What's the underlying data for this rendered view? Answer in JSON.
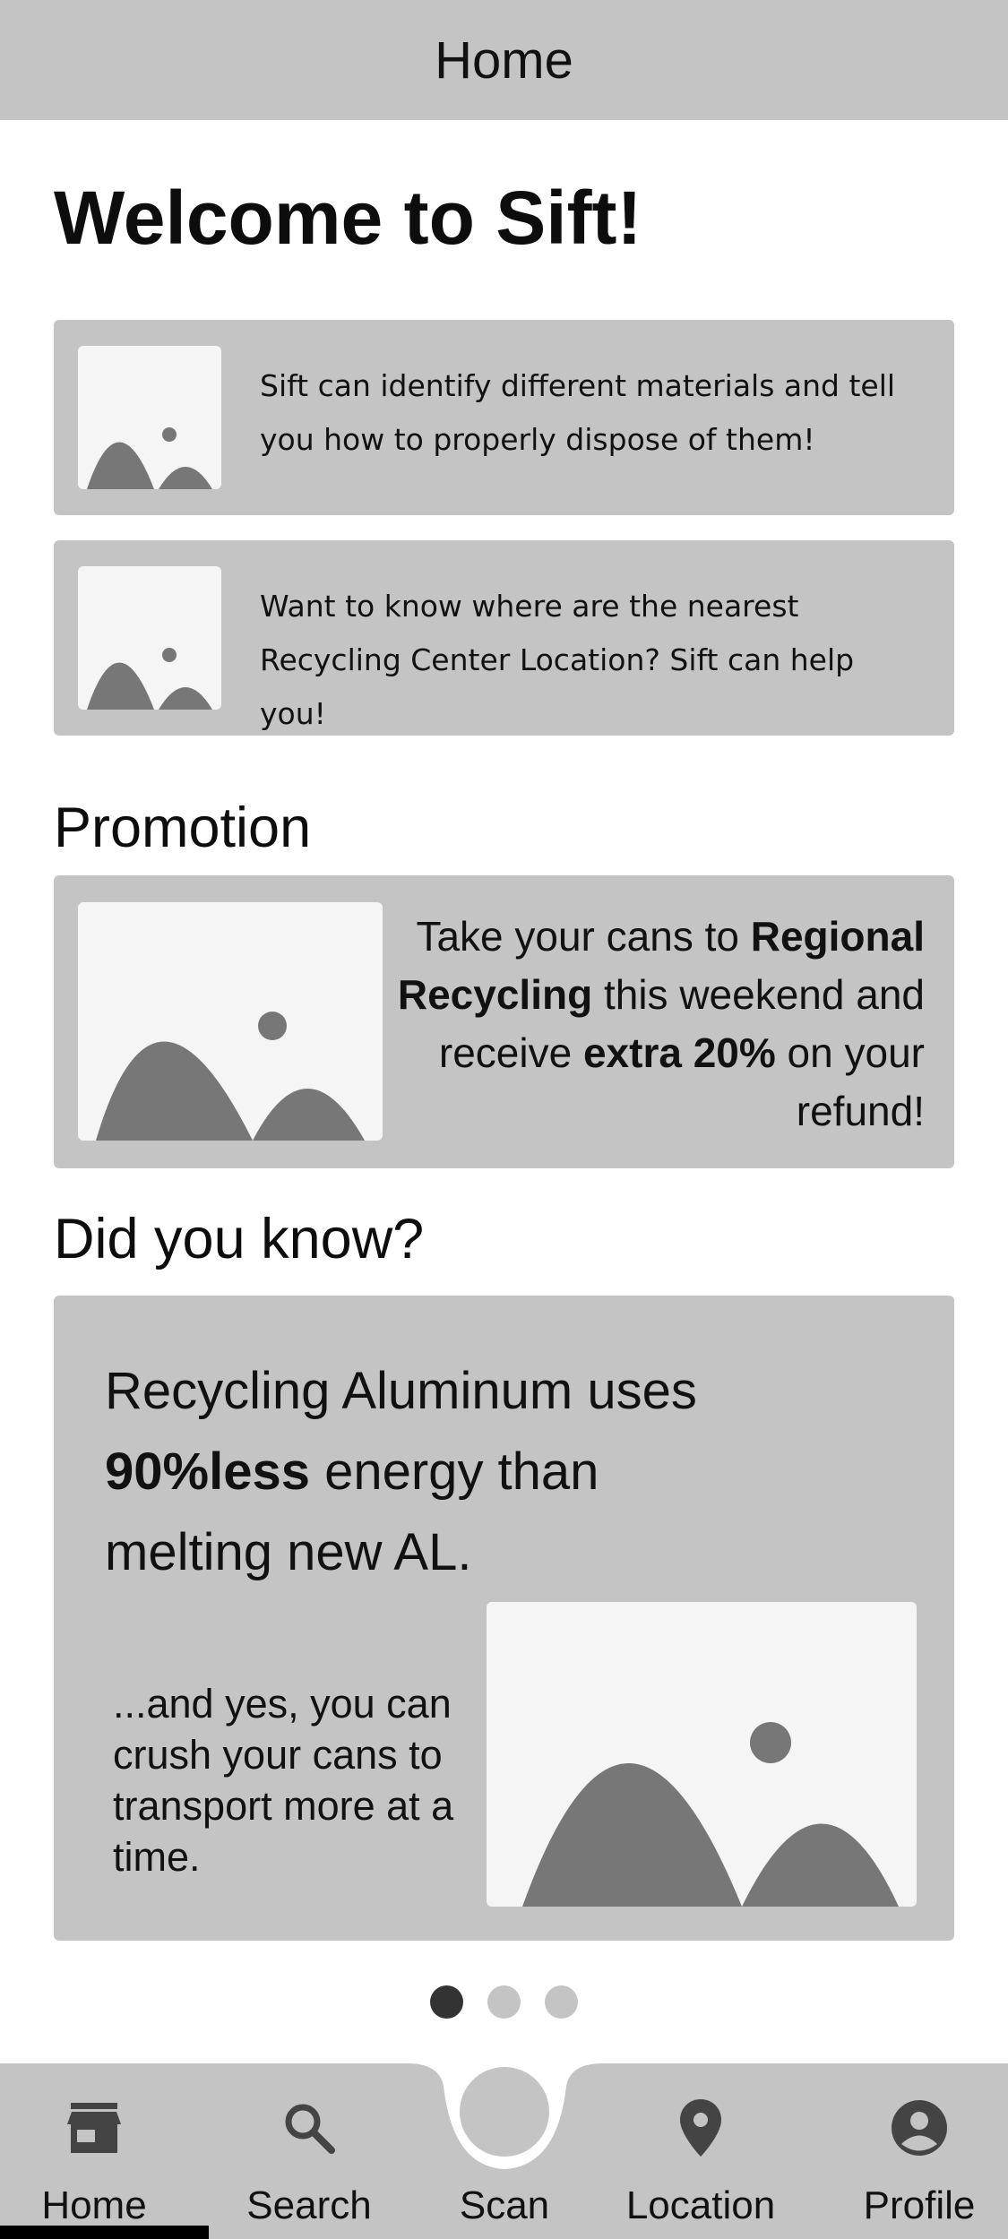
{
  "header": {
    "title": "Home"
  },
  "welcome": {
    "title": "Welcome to Sift!"
  },
  "info_cards": [
    {
      "text": "Sift can identify different materials and tell you how to properly dispose of them!",
      "icon": "image-placeholder-icon"
    },
    {
      "text": "Want to know where are the nearest Recycling Center Location? Sift can help you!",
      "icon": "image-placeholder-icon"
    }
  ],
  "promotion": {
    "title": "Promotion",
    "text_1": "Take your cans to ",
    "text_bold_1": "Regional Recycling",
    "text_2": " this weekend and receive ",
    "text_bold_2": "extra 20%",
    "text_3": " on your refund!"
  },
  "did_you_know": {
    "title": "Did you know?",
    "fact_1": "Recycling Aluminum uses ",
    "fact_bold": "90%less",
    "fact_2": " energy than melting new AL.",
    "note": "...and yes, you can crush your cans to transport more at a time."
  },
  "carousel": {
    "count": 3,
    "active_index": 0
  },
  "nav": {
    "items": [
      {
        "label": "Home",
        "icon": "store-icon"
      },
      {
        "label": "Search",
        "icon": "search-icon"
      },
      {
        "label": "Scan",
        "icon": "scan-button"
      },
      {
        "label": "Location",
        "icon": "location-pin-icon"
      },
      {
        "label": "Profile",
        "icon": "account-circle-icon"
      }
    ],
    "active": "Home"
  },
  "colors": {
    "card": "#c4c4c4",
    "placeholder_bg": "#f5f5f5",
    "placeholder_shape": "#777777",
    "active_dot": "#333333"
  }
}
